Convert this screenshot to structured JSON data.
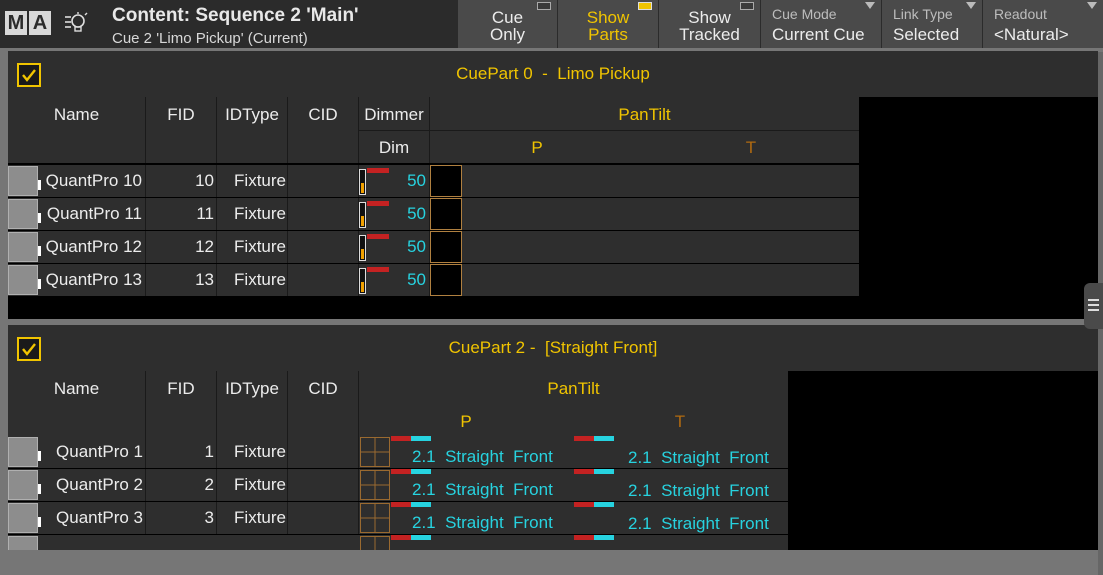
{
  "header": {
    "logo": [
      "M",
      "A"
    ],
    "title": "Content: Sequence 2 'Main'",
    "subtitle": "Cue 2 'Limo Pickup' (Current)"
  },
  "toolbar": {
    "cue_only": [
      "Cue",
      "Only"
    ],
    "show_parts": [
      "Show",
      "Parts"
    ],
    "show_tracked": [
      "Show",
      "Tracked"
    ],
    "cue_mode": {
      "label": "Cue Mode",
      "value": "Current Cue"
    },
    "link_type": {
      "label": "Link Type",
      "value": "Selected"
    },
    "readout": {
      "label": "Readout",
      "value": "<Natural>"
    }
  },
  "columns": {
    "name": "Name",
    "fid": "FID",
    "idtype": "IDType",
    "cid": "CID",
    "dimmer": "Dimmer",
    "dim": "Dim",
    "pantilt": "PanTilt",
    "p": "P",
    "t": "T"
  },
  "part0": {
    "title": "CuePart 0  -  Limo Pickup",
    "rows": [
      {
        "name": "QuantPro 10",
        "fid": "10",
        "idtype": "Fixture",
        "dim": "50"
      },
      {
        "name": "QuantPro 11",
        "fid": "11",
        "idtype": "Fixture",
        "dim": "50"
      },
      {
        "name": "QuantPro 12",
        "fid": "12",
        "idtype": "Fixture",
        "dim": "50"
      },
      {
        "name": "QuantPro 13",
        "fid": "13",
        "idtype": "Fixture",
        "dim": "50"
      }
    ]
  },
  "part2": {
    "title": "CuePart 2 -  [Straight Front]",
    "rows": [
      {
        "name": "QuantPro 1",
        "fid": "1",
        "idtype": "Fixture",
        "p": "2.1  Straight  Front",
        "t": "2.1  Straight  Front"
      },
      {
        "name": "QuantPro 2",
        "fid": "2",
        "idtype": "Fixture",
        "p": "2.1  Straight  Front",
        "t": "2.1  Straight  Front"
      },
      {
        "name": "QuantPro 3",
        "fid": "3",
        "idtype": "Fixture",
        "p": "2.1  Straight  Front",
        "t": "2.1  Straight  Front"
      }
    ]
  },
  "colors": {
    "accent": "#f0c400",
    "value": "#27d3e0",
    "tilt_header": "#b06a10",
    "marker_red": "#c42222"
  },
  "icons": [
    "bulb-settings-icon",
    "checkbox-checked-icon",
    "grip-handle-icon"
  ]
}
